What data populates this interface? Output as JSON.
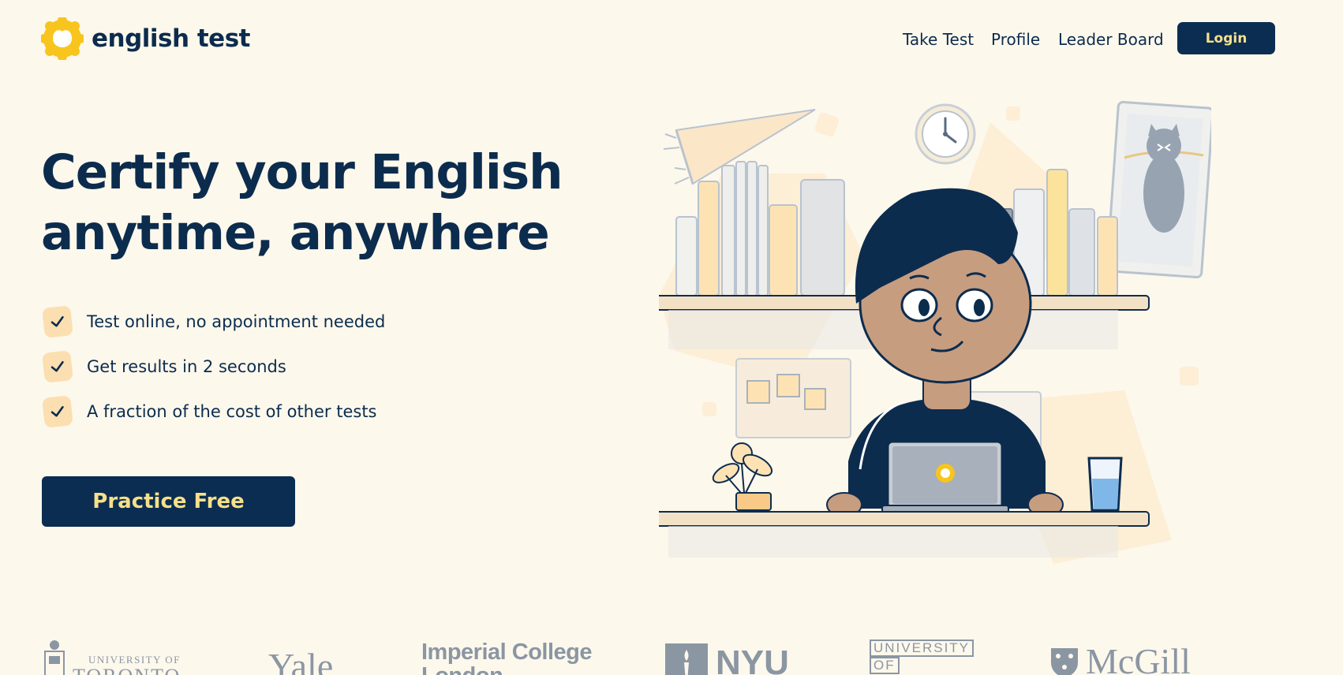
{
  "brand": {
    "name": "english test"
  },
  "nav": {
    "items": [
      "Take Test",
      "Profile",
      "Leader Board"
    ],
    "login_label": "Login"
  },
  "hero": {
    "title_line1": "Certify your English",
    "title_line2": "anytime, anywhere",
    "features": [
      "Test online, no appointment needed",
      "Get results in 2 seconds",
      "A fraction of the cost of other tests"
    ],
    "cta_label": "Practice Free"
  },
  "universities": {
    "toronto_line1": "UNIVERSITY OF",
    "toronto_line2": "TORONTO",
    "yale": "Yale",
    "imperial_line1": "Imperial College",
    "imperial_line2": "London",
    "nyu": "NYU",
    "uni_of_line1": "UNIVERSITY",
    "uni_of_line2": "OF",
    "mcgill": "McGill"
  },
  "colors": {
    "background": "#fdf8ec",
    "navy": "#0b2d52",
    "accent_yellow": "#f6e08a",
    "check_bg": "#fbdfb0",
    "logo_yellow": "#f7c51d"
  },
  "icons": {
    "logo": "yellow-flower-badge",
    "feature_check": "checkmark-icon"
  }
}
